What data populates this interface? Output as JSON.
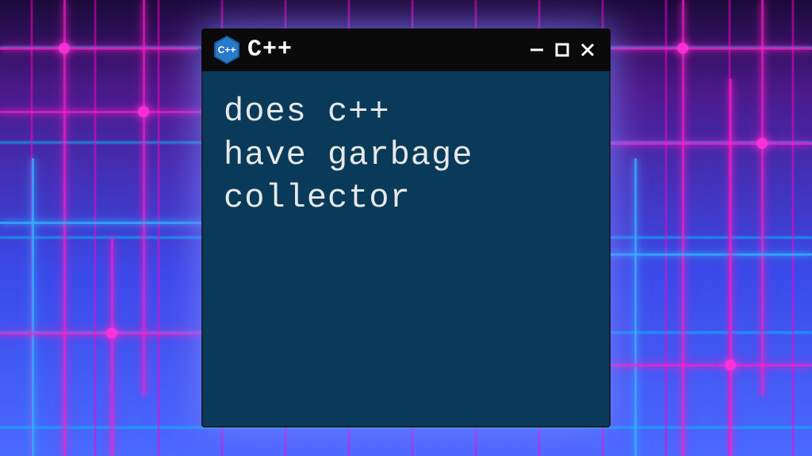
{
  "window": {
    "title": "C++",
    "icon_label": "C++",
    "content": "does c++\nhave garbage\ncollector"
  },
  "controls": {
    "minimize": "minimize",
    "maximize": "maximize",
    "close": "close"
  }
}
